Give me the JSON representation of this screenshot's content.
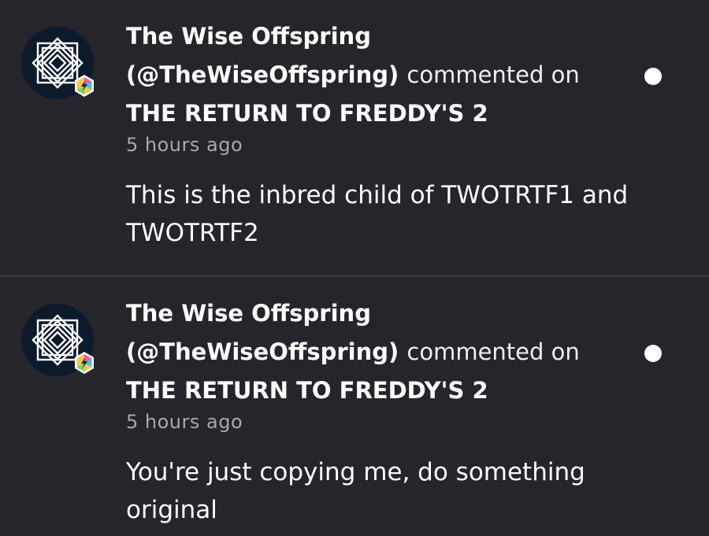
{
  "notifications": [
    {
      "author_name": "The Wise Offspring",
      "author_handle": "(@TheWiseOffspring)",
      "verb": "commented on",
      "target": "THE RETURN TO FREDDY'S 2",
      "time": "5 hours ago",
      "comment": "This is the inbred child of TWOTRTF1 and TWOTRTF2",
      "unread": true
    },
    {
      "author_name": "The Wise Offspring",
      "author_handle": "(@TheWiseOffspring)",
      "verb": "commented on",
      "target": "THE RETURN TO FREDDY'S 2",
      "time": "5 hours ago",
      "comment": "You're just copying me, do something original",
      "unread": true
    }
  ],
  "icons": {
    "avatar": "concentric-diamond-logo",
    "badge": "hexagon-lightning-badge",
    "unread": "unread-dot-icon"
  },
  "colors": {
    "background": "#26252b",
    "text": "#ffffff",
    "muted": "#a9a8ae",
    "divider": "#4a4950"
  }
}
